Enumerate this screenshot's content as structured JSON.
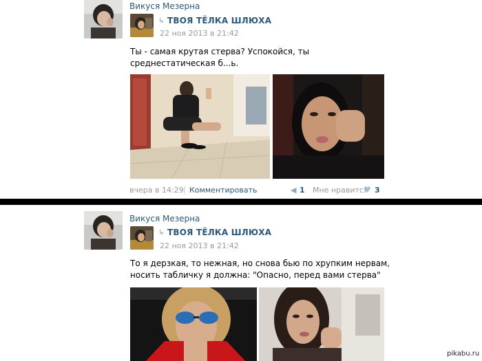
{
  "posts": [
    {
      "author": "Викуся Мезерна",
      "group": "ТВОЯ ТЁЛКА ШЛЮХА",
      "date": "22 ноя 2013 в 21:42",
      "text": "Ты - самая крутая стерва? Успокойся, ты среднестатическая б...ь.",
      "footer": {
        "time": "вчера в 14:29",
        "separator": "|",
        "comment_label": "Комментировать",
        "share_count": "1",
        "like_label": "Мне нравится",
        "like_count": "3"
      }
    },
    {
      "author": "Викуся Мезерна",
      "group": "ТВОЯ ТЁЛКА ШЛЮХА",
      "date": "22 ноя 2013 в 21:42",
      "text": "То я дерзкая, то нежная, но снова бью по хрупким нервам, носить табличку я должна: \"Опасно, перед вами стерва\""
    }
  ],
  "icons": {
    "repost": "repost-arrow-icon",
    "share": "megaphone-icon",
    "like": "heart-icon"
  },
  "colors": {
    "link": "#2b587a",
    "meta": "#999999",
    "divider": "#000000"
  },
  "watermark": "pikabu.ru"
}
